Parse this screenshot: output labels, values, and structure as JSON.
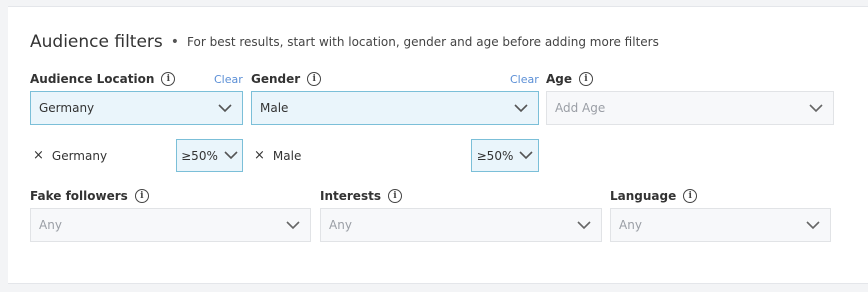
{
  "header": {
    "title": "Audience filters",
    "separator": "•",
    "subtitle": "For best results, start with location, gender and age before adding more filters"
  },
  "location": {
    "label": "Audience Location",
    "clear": "Clear",
    "value": "Germany",
    "chip": "Germany",
    "percent": "≥50%"
  },
  "gender": {
    "label": "Gender",
    "clear": "Clear",
    "value": "Male",
    "chip": "Male",
    "percent": "≥50%"
  },
  "age": {
    "label": "Age",
    "placeholder": "Add Age"
  },
  "fake_followers": {
    "label": "Fake followers",
    "value": "Any"
  },
  "interests": {
    "label": "Interests",
    "value": "Any"
  },
  "language": {
    "label": "Language",
    "value": "Any"
  },
  "icons": {
    "info": "info-icon",
    "chevron": "chevron-down-icon",
    "remove": "close-icon"
  },
  "colors": {
    "active_bg": "#eaf5fb",
    "active_border": "#7bbfd8",
    "link": "#5b8fd6"
  }
}
